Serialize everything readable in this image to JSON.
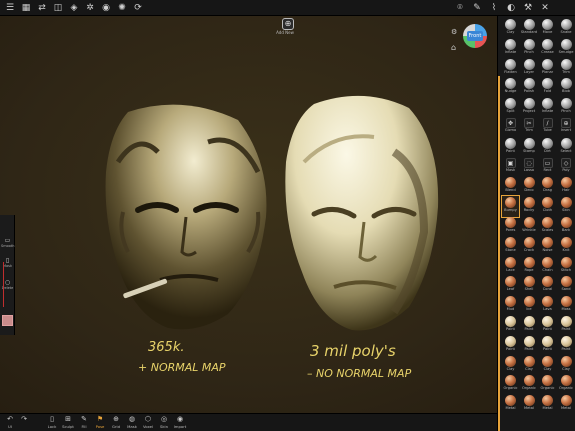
{
  "top_toolbar": {
    "left_icons": [
      "menu-icon",
      "grid-icon",
      "share-icon",
      "layers-icon",
      "cube-icon",
      "settings-icon",
      "camera-icon",
      "shading-icon",
      "history-icon"
    ],
    "right_icons": [
      "camera-icon",
      "pen-icon",
      "brush-icon",
      "palette-icon",
      "tools-icon",
      "close-icon"
    ]
  },
  "add_new": {
    "label": "Add New"
  },
  "view_cube": {
    "label": "Front"
  },
  "left_panel": {
    "items": [
      {
        "label": "Smooth"
      },
      {
        "label": "Mask"
      },
      {
        "label": "Delete"
      }
    ]
  },
  "bottom_bar": {
    "items": [
      {
        "label": "UI"
      },
      {
        "label": "Lock"
      },
      {
        "label": "Sculpt"
      },
      {
        "label": "Fill"
      },
      {
        "label": "Pose"
      },
      {
        "label": "Grid"
      },
      {
        "label": "Mask"
      },
      {
        "label": "Voxel"
      },
      {
        "label": "Skin"
      },
      {
        "label": "Import"
      }
    ],
    "active": "Pose"
  },
  "annotations": {
    "left_line1": "365k.",
    "left_line2": "+ NORMAL MAP",
    "right_line1": "3 mil poly's",
    "right_line2": "– NO NORMAL MAP"
  },
  "colors": {
    "background": "#2f2616",
    "accent": "#e6a33a",
    "annotation": "#e8d36a",
    "toolbar": "#161616"
  },
  "brushes": [
    {
      "name": "Clay",
      "kind": "gray"
    },
    {
      "name": "Standard",
      "kind": "gray"
    },
    {
      "name": "Move",
      "kind": "gray"
    },
    {
      "name": "Snake",
      "kind": "gray"
    },
    {
      "name": "Inflate",
      "kind": "gray"
    },
    {
      "name": "Pinch",
      "kind": "gray"
    },
    {
      "name": "Crease",
      "kind": "gray"
    },
    {
      "name": "Smudge",
      "kind": "gray"
    },
    {
      "name": "Flatten",
      "kind": "gray"
    },
    {
      "name": "Layer",
      "kind": "gray"
    },
    {
      "name": "Planar",
      "kind": "gray"
    },
    {
      "name": "Trim",
      "kind": "gray"
    },
    {
      "name": "Nudge",
      "kind": "gray"
    },
    {
      "name": "Polish",
      "kind": "gray"
    },
    {
      "name": "Fold",
      "kind": "gray"
    },
    {
      "name": "Blob",
      "kind": "gray"
    },
    {
      "name": "Split",
      "kind": "gray"
    },
    {
      "name": "Project",
      "kind": "gray"
    },
    {
      "name": "Inflate",
      "kind": "gray"
    },
    {
      "name": "Pinch",
      "kind": "gray"
    },
    {
      "name": "Gizmo",
      "kind": "tool"
    },
    {
      "name": "Trim",
      "kind": "tool"
    },
    {
      "name": "Tube",
      "kind": "tool"
    },
    {
      "name": "Insert",
      "kind": "tool"
    },
    {
      "name": "Paint",
      "kind": "gray"
    },
    {
      "name": "Stamp",
      "kind": "gray"
    },
    {
      "name": "Dirt",
      "kind": "gray"
    },
    {
      "name": "Select",
      "kind": "gray"
    },
    {
      "name": "Mask",
      "kind": "tool"
    },
    {
      "name": "Lasso",
      "kind": "tool"
    },
    {
      "name": "Rect",
      "kind": "tool"
    },
    {
      "name": "Poly",
      "kind": "tool"
    },
    {
      "name": "Blend",
      "kind": "copper"
    },
    {
      "name": "Deco",
      "kind": "copper"
    },
    {
      "name": "Drag",
      "kind": "copper"
    },
    {
      "name": "Hair",
      "kind": "copper"
    },
    {
      "name": "Bumpy",
      "kind": "copper"
    },
    {
      "name": "Rocky",
      "kind": "copper"
    },
    {
      "name": "Cloth",
      "kind": "copper"
    },
    {
      "name": "Skin",
      "kind": "copper"
    },
    {
      "name": "Pores",
      "kind": "copper"
    },
    {
      "name": "Wrinkle",
      "kind": "copper"
    },
    {
      "name": "Scales",
      "kind": "copper"
    },
    {
      "name": "Bark",
      "kind": "copper"
    },
    {
      "name": "Stone",
      "kind": "copper"
    },
    {
      "name": "Crack",
      "kind": "copper"
    },
    {
      "name": "Noise",
      "kind": "copper"
    },
    {
      "name": "Knit",
      "kind": "copper"
    },
    {
      "name": "Lace",
      "kind": "copper"
    },
    {
      "name": "Rope",
      "kind": "copper"
    },
    {
      "name": "Chain",
      "kind": "copper"
    },
    {
      "name": "Stitch",
      "kind": "copper"
    },
    {
      "name": "Leaf",
      "kind": "copper"
    },
    {
      "name": "Shell",
      "kind": "copper"
    },
    {
      "name": "Coral",
      "kind": "copper"
    },
    {
      "name": "Sand",
      "kind": "copper"
    },
    {
      "name": "Mud",
      "kind": "copper"
    },
    {
      "name": "Ice",
      "kind": "copper"
    },
    {
      "name": "Lava",
      "kind": "copper"
    },
    {
      "name": "Moss",
      "kind": "copper"
    },
    {
      "name": "Paint",
      "kind": "cream"
    },
    {
      "name": "Paint",
      "kind": "cream"
    },
    {
      "name": "Paint",
      "kind": "cream"
    },
    {
      "name": "Paint",
      "kind": "cream"
    },
    {
      "name": "Paint",
      "kind": "cream"
    },
    {
      "name": "Paint",
      "kind": "cream"
    },
    {
      "name": "Paint",
      "kind": "cream"
    },
    {
      "name": "Paint",
      "kind": "cream"
    },
    {
      "name": "Clay",
      "kind": "copper"
    },
    {
      "name": "Clay",
      "kind": "copper"
    },
    {
      "name": "Clay",
      "kind": "copper"
    },
    {
      "name": "Clay",
      "kind": "copper"
    },
    {
      "name": "Organic",
      "kind": "copper"
    },
    {
      "name": "Organic",
      "kind": "copper"
    },
    {
      "name": "Organic",
      "kind": "copper"
    },
    {
      "name": "Organic",
      "kind": "copper"
    },
    {
      "name": "Metal",
      "kind": "copper"
    },
    {
      "name": "Metal",
      "kind": "copper"
    },
    {
      "name": "Metal",
      "kind": "copper"
    },
    {
      "name": "Metal",
      "kind": "copper"
    }
  ]
}
